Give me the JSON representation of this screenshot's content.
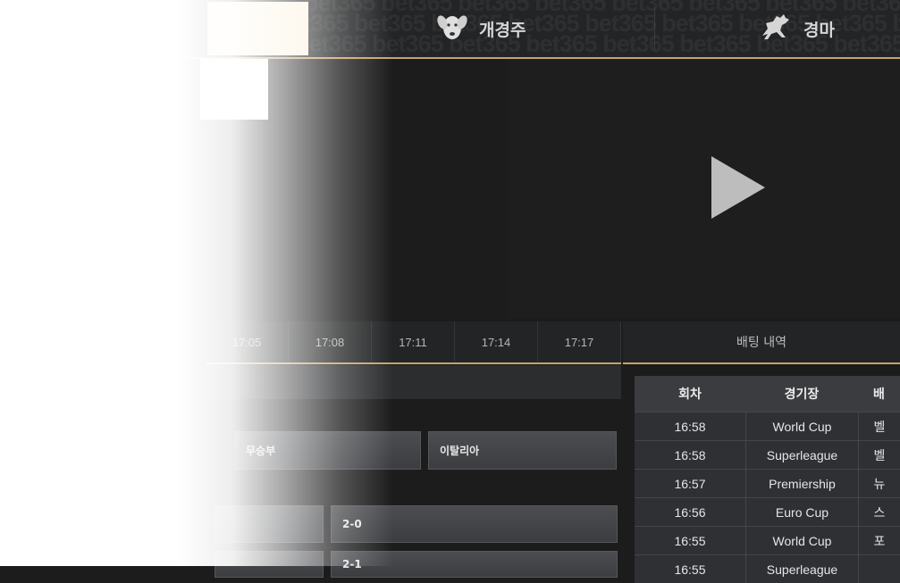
{
  "nav": {
    "watermark": "bet365 bet365 bet365 bet365 bet365 bet365 bet365 bet365 bet365 bet365",
    "greyhound_label": "개경주",
    "horse_label": "경마"
  },
  "time_tabs": [
    "17:05",
    "17:08",
    "17:11",
    "17:14",
    "17:17"
  ],
  "bet_history_label": "배팅 내역",
  "bets": {
    "row1": [
      "무승부",
      "이탈리아"
    ],
    "row2": [
      "",
      "2-0"
    ],
    "row3": [
      "",
      "2-1"
    ]
  },
  "history": {
    "headers": [
      "회차",
      "경기장",
      "배"
    ],
    "rows": [
      [
        "16:58",
        "World Cup",
        "벨"
      ],
      [
        "16:58",
        "Superleague",
        "벨"
      ],
      [
        "16:57",
        "Premiership",
        "뉴"
      ],
      [
        "16:56",
        "Euro Cup",
        "스"
      ],
      [
        "16:55",
        "World Cup",
        "포"
      ],
      [
        "16:55",
        "Superleague",
        ""
      ]
    ]
  },
  "colors": {
    "accent": "#c8a36a",
    "background": "#1c1c1c"
  }
}
